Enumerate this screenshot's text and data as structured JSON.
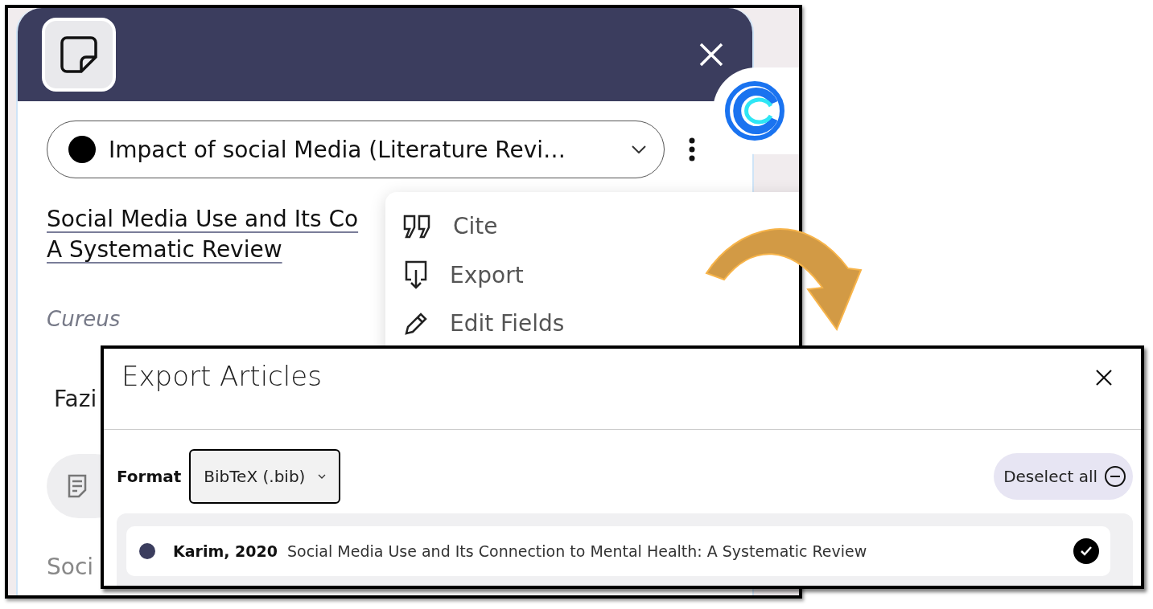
{
  "library_panel": {
    "collection_select": {
      "value": "Impact of social Media (Literature Revi…",
      "color": "#000000"
    },
    "article_title": [
      "Social Media Use and Its Co",
      "A Systematic Review"
    ],
    "journal": "Cureus",
    "authors": "Fazi",
    "section_heading": "Soci",
    "menu": [
      {
        "kind": "cite",
        "label": "Cite"
      },
      {
        "kind": "export",
        "label": "Export"
      },
      {
        "kind": "edit",
        "label": "Edit Fields"
      }
    ]
  },
  "export_dialog": {
    "title": "Export Articles",
    "format_label": "Format",
    "format_value": "BibTeX (.bib)",
    "deselect_button": "Deselect all",
    "articles": [
      {
        "author_year": "Karim, 2020",
        "title": "Social Media Use and Its Connection to Mental Health: A Systematic Review",
        "color": "#3b3d5e",
        "checked": true
      }
    ]
  }
}
